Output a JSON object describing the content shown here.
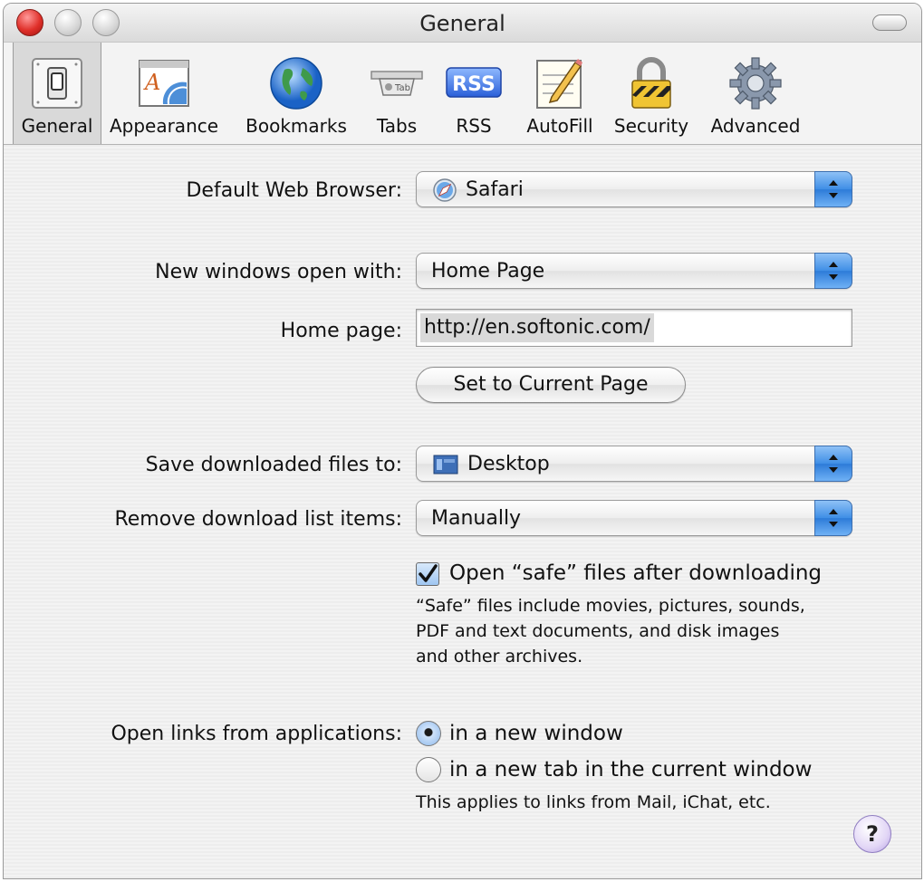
{
  "window": {
    "title": "General"
  },
  "toolbar": {
    "tabs": [
      {
        "label": "General",
        "icon": "light-switch-icon",
        "selected": true
      },
      {
        "label": "Appearance",
        "icon": "font-icon",
        "selected": false
      },
      {
        "label": "Bookmarks",
        "icon": "globe-icon",
        "selected": false
      },
      {
        "label": "Tabs",
        "icon": "tab-icon",
        "selected": false
      },
      {
        "label": "RSS",
        "icon": "rss-icon",
        "selected": false
      },
      {
        "label": "AutoFill",
        "icon": "pencil-form-icon",
        "selected": false
      },
      {
        "label": "Security",
        "icon": "lock-icon",
        "selected": false
      },
      {
        "label": "Advanced",
        "icon": "gear-icon",
        "selected": false
      }
    ]
  },
  "settings": {
    "default_browser": {
      "label": "Default Web Browser:",
      "value": "Safari",
      "icon": "safari-compass-icon"
    },
    "new_windows": {
      "label": "New windows open with:",
      "value": "Home Page"
    },
    "home_page": {
      "label": "Home page:",
      "value": "http://en.softonic.com/",
      "button": "Set to Current Page"
    },
    "save_downloads": {
      "label": "Save downloaded files to:",
      "value": "Desktop",
      "icon": "desktop-folder-icon"
    },
    "remove_downloads": {
      "label": "Remove download list items:",
      "value": "Manually"
    },
    "open_safe": {
      "label": "Open “safe” files after downloading",
      "checked": true,
      "note_lines": [
        "“Safe” files include movies, pictures, sounds,",
        "PDF and text documents, and disk images",
        "and other archives."
      ]
    },
    "open_links": {
      "label": "Open links from applications:",
      "options": [
        {
          "label": "in a new window",
          "selected": true
        },
        {
          "label": "in a new tab in the current window",
          "selected": false
        }
      ],
      "note": "This applies to links from Mail, iChat, etc."
    }
  },
  "help": {
    "label": "?"
  },
  "colors": {
    "accent": "#3f8ee6",
    "close_red": "#e0302a"
  }
}
